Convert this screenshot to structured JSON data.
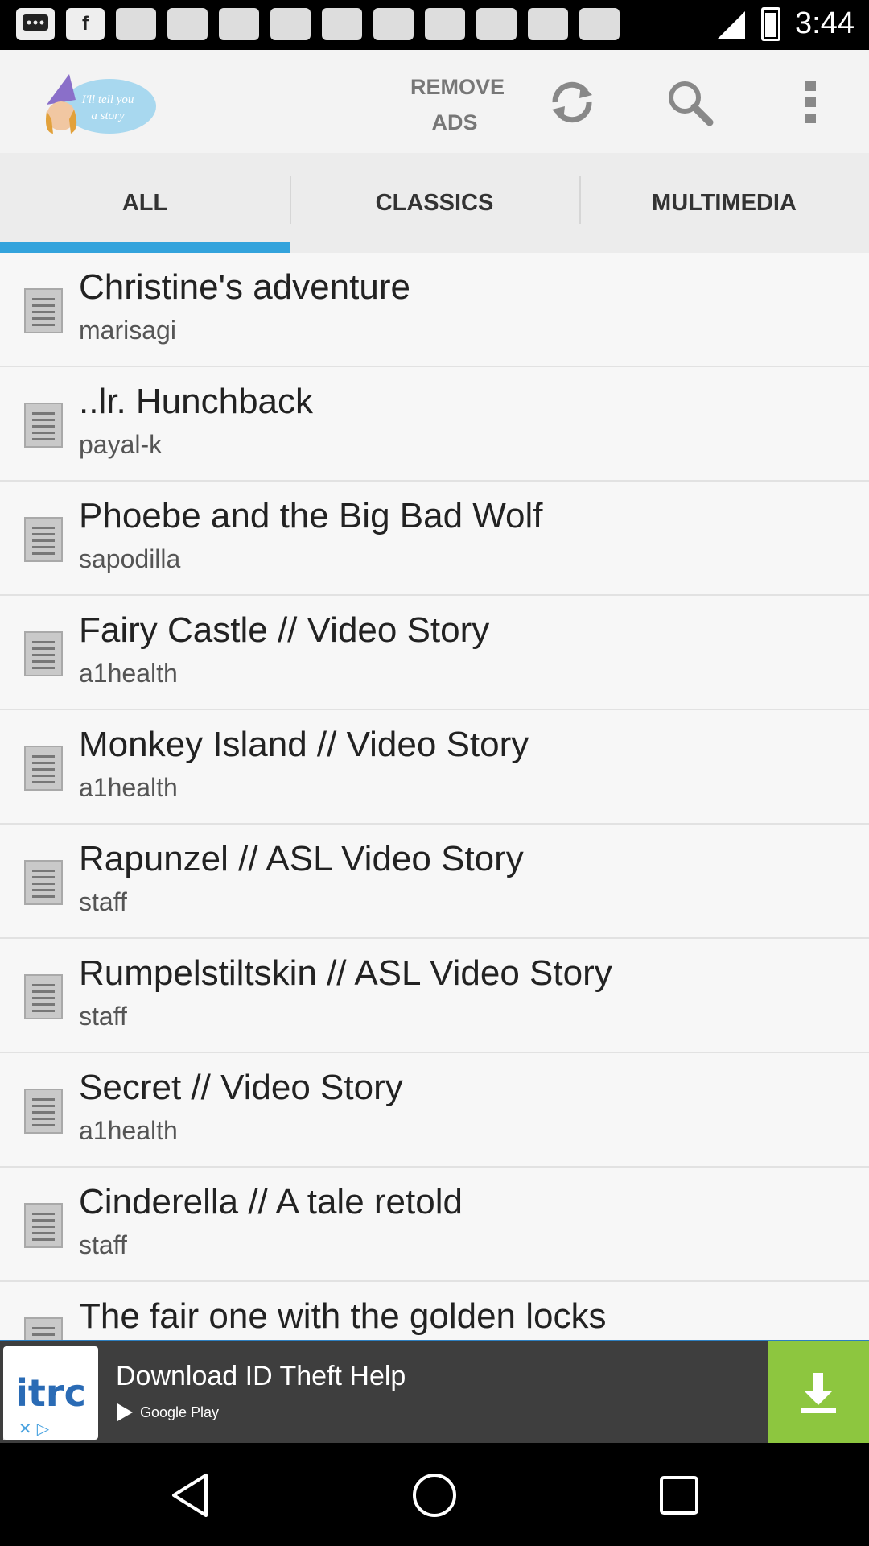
{
  "status_bar": {
    "time": "3:44",
    "notification_icons": [
      "messages-icon",
      "facebook-icon",
      "blank-notification",
      "blank-notification",
      "blank-notification",
      "blank-notification",
      "blank-notification",
      "blank-notification",
      "blank-notification",
      "blank-notification",
      "blank-notification",
      "blank-notification"
    ],
    "facebook_glyph": "f"
  },
  "app_bar": {
    "logo_text": "I'll tell you a story",
    "remove_ads_line1": "REMOVE",
    "remove_ads_line2": "ADS",
    "icons": [
      "refresh-icon",
      "search-icon",
      "more-vert-icon"
    ]
  },
  "tabs": [
    {
      "label": "ALL",
      "active": true
    },
    {
      "label": "CLASSICS",
      "active": false
    },
    {
      "label": "MULTIMEDIA",
      "active": false
    }
  ],
  "stories": [
    {
      "title": "Christine's adventure",
      "author": "marisagi"
    },
    {
      "title": "..lr. Hunchback",
      "author": "payal-k"
    },
    {
      "title": "Phoebe and the Big Bad Wolf",
      "author": "sapodilla"
    },
    {
      "title": "Fairy Castle // Video Story",
      "author": "a1health"
    },
    {
      "title": "Monkey Island // Video Story",
      "author": "a1health"
    },
    {
      "title": "Rapunzel // ASL Video Story",
      "author": "staff"
    },
    {
      "title": "Rumpelstiltskin // ASL Video Story",
      "author": "staff"
    },
    {
      "title": "Secret // Video Story",
      "author": "a1health"
    },
    {
      "title": "Cinderella // A tale retold",
      "author": "staff"
    },
    {
      "title": "The fair one with the golden locks",
      "author": ""
    }
  ],
  "ad": {
    "logo": "itrc",
    "title": "Download ID Theft Help",
    "store": "Google Play"
  },
  "colors": {
    "tab_indicator": "#33a3dc",
    "ad_download": "#8dc63f",
    "ad_background": "#3e3e3e"
  }
}
